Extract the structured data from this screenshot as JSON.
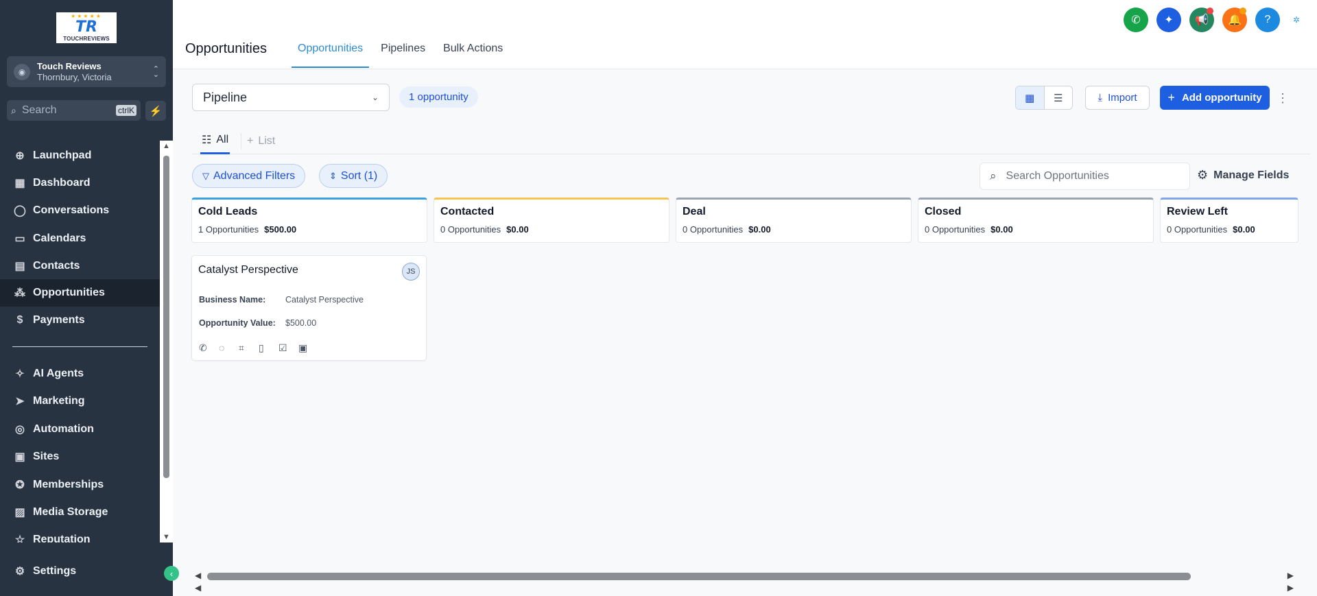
{
  "brand": {
    "logo_text": "TOUCHREVIEWS",
    "logo_mark": "TR"
  },
  "account": {
    "name": "Touch Reviews",
    "location": "Thornbury, Victoria"
  },
  "search": {
    "placeholder": "Search",
    "shortcut": "ctrlK"
  },
  "nav": {
    "items": [
      {
        "label": "Launchpad",
        "icon": "rocket-icon"
      },
      {
        "label": "Dashboard",
        "icon": "grid-icon"
      },
      {
        "label": "Conversations",
        "icon": "chat-icon"
      },
      {
        "label": "Calendars",
        "icon": "calendar-icon"
      },
      {
        "label": "Contacts",
        "icon": "contacts-icon"
      },
      {
        "label": "Opportunities",
        "icon": "funnel-icon",
        "active": true
      },
      {
        "label": "Payments",
        "icon": "dollar-icon"
      }
    ],
    "items2": [
      {
        "label": "AI Agents",
        "icon": "sparkle-icon"
      },
      {
        "label": "Marketing",
        "icon": "send-icon"
      },
      {
        "label": "Automation",
        "icon": "automation-icon"
      },
      {
        "label": "Sites",
        "icon": "globe-icon"
      },
      {
        "label": "Memberships",
        "icon": "badge-icon"
      },
      {
        "label": "Media Storage",
        "icon": "image-icon"
      },
      {
        "label": "Reputation",
        "icon": "star-icon"
      }
    ],
    "settings": "Settings"
  },
  "header": {
    "title": "Opportunities",
    "tabs": [
      "Opportunities",
      "Pipelines",
      "Bulk Actions"
    ]
  },
  "toolbar": {
    "pipeline": "Pipeline",
    "count": "1 opportunity",
    "import": "Import",
    "add": "Add opportunity"
  },
  "list_tabs": {
    "all": "All",
    "list": "List"
  },
  "filters": {
    "advanced": "Advanced Filters",
    "sort": "Sort (1)",
    "search_placeholder": "Search Opportunities",
    "manage_fields": "Manage Fields"
  },
  "stages": [
    {
      "name": "Cold Leads",
      "count": "1 Opportunities",
      "amount": "$500.00",
      "color": "#3aa0e0"
    },
    {
      "name": "Contacted",
      "count": "0 Opportunities",
      "amount": "$0.00",
      "color": "#f5c451"
    },
    {
      "name": "Deal",
      "count": "0 Opportunities",
      "amount": "$0.00",
      "color": "#9aa5b1"
    },
    {
      "name": "Closed",
      "count": "0 Opportunities",
      "amount": "$0.00",
      "color": "#9aa5b1"
    },
    {
      "name": "Review Left",
      "count": "0 Opportunities",
      "amount": "$0.00",
      "color": "#7ea6e8"
    }
  ],
  "card": {
    "title": "Catalyst Perspective",
    "initials": "JS",
    "business_label": "Business Name:",
    "business_value": "Catalyst Perspective",
    "value_label": "Opportunity Value:",
    "value_value": "$500.00"
  },
  "colors": {
    "sidebar": "#283342",
    "accent": "#1d5fe0",
    "link": "#2d8bd0"
  }
}
